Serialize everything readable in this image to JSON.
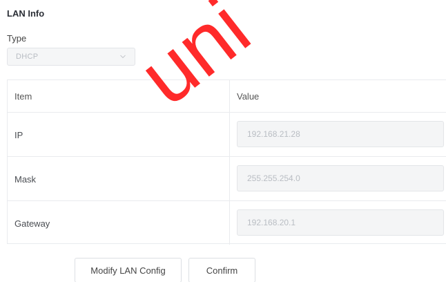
{
  "section": {
    "title": "LAN Info"
  },
  "type_field": {
    "label": "Type",
    "selected": "DHCP",
    "icon": "chevron-down-icon"
  },
  "table": {
    "headers": [
      "Item",
      "Value"
    ],
    "rows": [
      {
        "item": "IP",
        "value": "192.168.21.28"
      },
      {
        "item": "Mask",
        "value": "255.255.254.0"
      },
      {
        "item": "Gateway",
        "value": "192.168.20.1"
      }
    ]
  },
  "buttons": {
    "modify": "Modify LAN Config",
    "confirm": "Confirm"
  },
  "watermark": {
    "text": "uni",
    "color": "#ff2a2a"
  },
  "colors": {
    "border": "#e9ebee",
    "disabled_bg": "#f4f5f6",
    "disabled_text": "#b9bdc3"
  }
}
